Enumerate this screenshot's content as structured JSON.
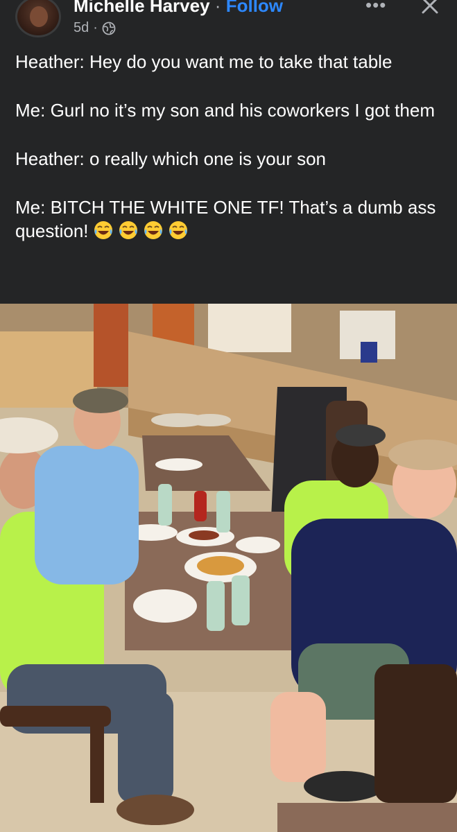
{
  "post": {
    "author": "Michelle Harvey",
    "separator": "·",
    "follow_label": "Follow",
    "time": "5d",
    "time_separator": "·",
    "paragraphs": [
      "Heather: Hey do you want me to take that table",
      "Me: Gurl no it’s my son and his coworkers I got them",
      "Heather: o really which one is your son",
      "Me: BITCH THE WHITE ONE TF! That’s a dumb ass question!"
    ],
    "emoji_icons": [
      "face-with-tears-of-joy-icon",
      "face-with-tears-of-joy-icon",
      "face-with-tears-of-joy-icon",
      "face-with-tears-of-joy-icon"
    ],
    "icons": {
      "more": "more-dots-icon",
      "close": "close-icon",
      "audience": "globe-icon"
    }
  },
  "colors": {
    "background": "#242526",
    "text": "#ffffff",
    "secondary_text": "#b0b3b8",
    "follow": "#2d88ff",
    "emoji_yellow": "#ffcc33"
  }
}
